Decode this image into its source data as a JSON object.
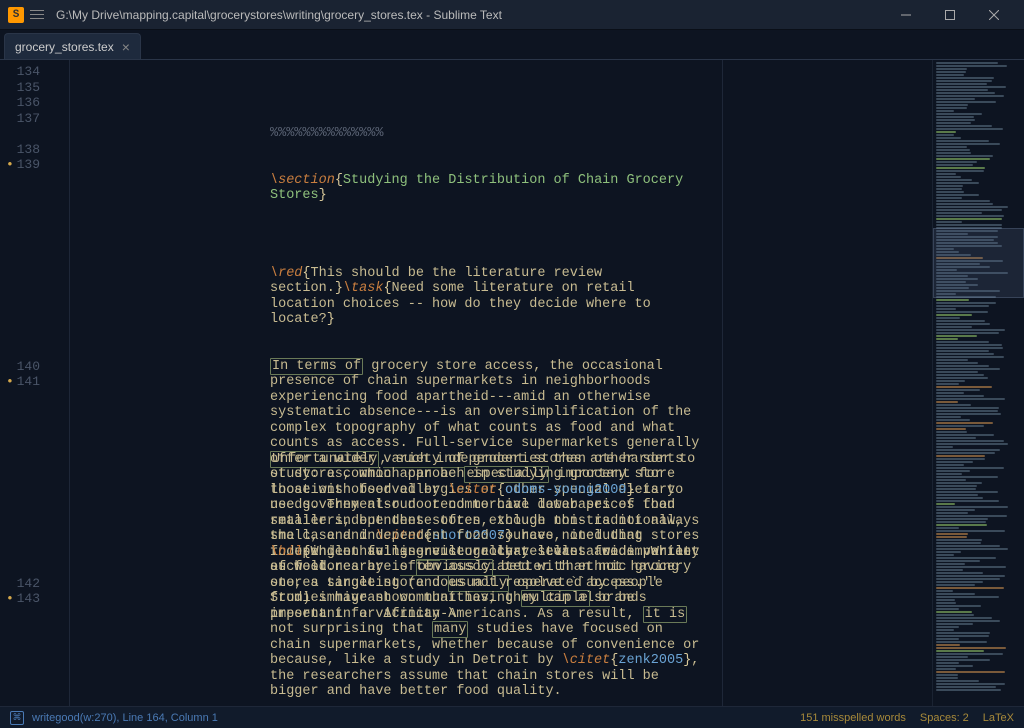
{
  "titlebar": {
    "path": "G:\\My Drive\\mapping.capital\\grocerystores\\writing\\grocery_stores.tex - Sublime Text"
  },
  "tabs": [
    {
      "label": "grocery_stores.tex"
    }
  ],
  "gutter": {
    "lines": [
      "134",
      "135",
      "136",
      "137",
      "",
      "138",
      "139",
      "",
      "",
      "",
      "",
      "",
      "",
      "",
      "",
      "",
      "",
      "",
      "",
      "140",
      "141",
      "",
      "",
      "",
      "",
      "",
      "",
      "",
      "",
      "",
      "",
      "",
      "",
      "142",
      "143"
    ],
    "modified": [
      false,
      false,
      false,
      false,
      false,
      false,
      true,
      false,
      false,
      false,
      false,
      false,
      false,
      false,
      false,
      false,
      false,
      false,
      false,
      false,
      true,
      false,
      false,
      false,
      false,
      false,
      false,
      false,
      false,
      false,
      false,
      false,
      false,
      false,
      true
    ]
  },
  "code": {
    "l134": "%%%%%%%%%%%%%%",
    "l135_cmd": "\\section",
    "l135_arg": "Studying the Distribution of Chain Grocery Stores",
    "l137_red": "\\red",
    "l137_redtxt": "This should be the literature review section.",
    "l137_task": "\\task",
    "l137_tasktxt1": "Need some literature on retail location choices -- how do they decide where to locate?",
    "p139_box1": "In terms of",
    "p139_a": " grocery store access, the occasional presence of chain supermarkets in neighborhoods experiencing food apartheid---amid an otherwise systematic absence---is an oversimplification of the complex topography of what counts as food and what counts as access. Full-service supermarkets generally offer a wider ",
    "p139_u1": "variety of",
    "p139_b": " groceries than other sorts of stores, which can be ",
    "p139_box2": "especially",
    "p139_c": " important for those with food allergies or other special dietary needs. They also do tend to have lower prices than smaller independent stores, though this is not always the case and ",
    "p139_citet": "\\citet",
    "p139_cite": "short2007",
    "p139_d": " have noted that independent full-service grocery stores are important as well.",
    "p141_box1": "Unfortunately",
    "p141_a": ", such independent stores are harder to study: a common approach in studying grocery store locations observed by ",
    "p141_citet": "\\citet",
    "p141_cite1": "odoms-young2009",
    "p141_b": " is to use government-run or commercial databases of food retailers, but these often exclude non-traditional, small, and independent food sources, including stores focusing on selling culturally-relevant foods. While such stores are ",
    "p141_u1": "often",
    "p141_c": " associated with ethnic grocery stores targeting (and ",
    "p141_box2": "usually",
    "p141_d": " operated by people from) immigrant communities, they can ",
    "p141_u2": "also",
    "p141_e": " be important for African-Americans. As a result, ",
    "p141_box3": "it is",
    "p141_f": " not surprising that ",
    "p141_box4": "many",
    "p141_g": " studies have focused on chain supermarkets, whether because of convenience or because, like a study in Detroit by ",
    "p141_citet2": "\\citet",
    "p141_cite2": "zenk2005",
    "p141_h": ", the researchers assume that chain stores will be bigger and have better food quality.",
    "p143_hil": "\\hil",
    "p143_a": "While having ",
    "p143_u1": "one",
    "p143_b": " store that sells a wide variety of food nearby is ",
    "p143_box1": "obviously",
    "p143_c": " better than not having one, a single store does ",
    "p143_u2": "not",
    "p143_d": " resolve ``access.'' Studies have shown that having ",
    "p143_box2": "multiple",
    "p143_e": " brands present in a vicinity \\"
  },
  "status": {
    "left": "writegood(w:270), Line 164, Column 1",
    "spell": "151 misspelled words",
    "spaces": "Spaces: 2",
    "syntax": "LaTeX"
  }
}
